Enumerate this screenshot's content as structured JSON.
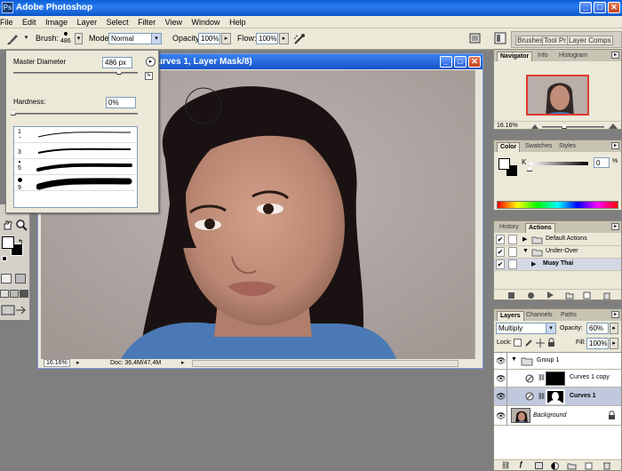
{
  "app": {
    "title": "Adobe Photoshop",
    "icon_name": "photoshop-app-icon"
  },
  "menu": [
    "File",
    "Edit",
    "Image",
    "Layer",
    "Select",
    "Filter",
    "View",
    "Window",
    "Help"
  ],
  "options": {
    "brush_label": "Brush:",
    "brush_size": "486",
    "mode_label": "Mode:",
    "mode_value": "Normal",
    "opacity_label": "Opacity:",
    "opacity_value": "100%",
    "flow_label": "Flow:",
    "flow_value": "100%",
    "palette_well_tabs": [
      "Brushes",
      "Tool Pr",
      "Layer Comps"
    ]
  },
  "brush_popup": {
    "master_diameter_label": "Master Diameter",
    "master_diameter_value": "486 px",
    "master_diameter_level": 0.85,
    "hardness_label": "Hardness:",
    "hardness_value": "0%",
    "hardness_level": 0.0,
    "presets": [
      {
        "size": "1",
        "stroke": 1
      },
      {
        "size": "3",
        "stroke": 2
      },
      {
        "size": "5",
        "stroke": 4
      },
      {
        "size": "9",
        "stroke": 7
      }
    ]
  },
  "document": {
    "title": "urves 1, Layer Mask/8)",
    "zoom": "16.16%",
    "doc_size": "Doc: 36,4M/47,4M"
  },
  "navigator": {
    "tabs": [
      "Navigator",
      "Info",
      "Histogram"
    ],
    "zoom": "16.16%"
  },
  "color": {
    "tabs": [
      "Color",
      "Swatches",
      "Styles"
    ],
    "channel_label": "K",
    "channel_value": "0",
    "unit": "%"
  },
  "history": {
    "tabs": [
      "History",
      "Actions"
    ],
    "items": [
      {
        "label": "Default Actions",
        "type": "set",
        "expanded": false
      },
      {
        "label": "Under-Over",
        "type": "set",
        "expanded": true
      },
      {
        "label": "Muay Thai",
        "type": "action",
        "selected": true
      }
    ]
  },
  "layers": {
    "tabs": [
      "Layers",
      "Channels",
      "Paths"
    ],
    "blend_mode": "Multiply",
    "opacity_label": "Opacity:",
    "opacity_value": "60%",
    "lock_label": "Lock:",
    "fill_label": "Fill:",
    "fill_value": "100%",
    "items": [
      {
        "name": "Group 1",
        "type": "group"
      },
      {
        "name": "Curves 1 copy",
        "type": "adjustment"
      },
      {
        "name": "Curves 1",
        "type": "adjustment",
        "selected": true
      },
      {
        "name": "Background",
        "type": "image",
        "italic": true
      }
    ]
  },
  "colors": {
    "titlebar": "#0a5fd6",
    "panel": "#ece9d8",
    "workspace": "#7f7f7f",
    "selection": "#bfc8dc"
  }
}
